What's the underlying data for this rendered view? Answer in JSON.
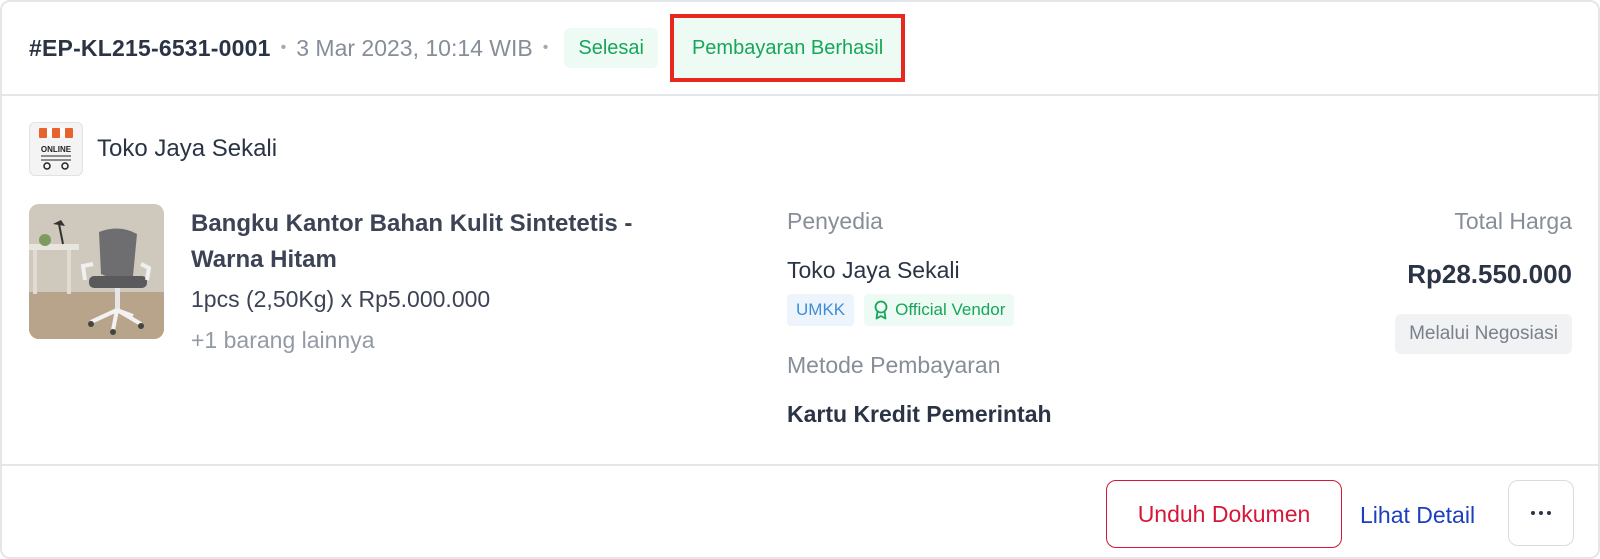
{
  "header": {
    "order_id": "#EP-KL215-6531-0001",
    "order_date": "3 Mar 2023, 10:14 WIB",
    "status_badge": "Selesai",
    "payment_badge": "Pembayaran Berhasil"
  },
  "shop": {
    "name": "Toko Jaya Sekali",
    "logo_text": "ONLINE SHOP"
  },
  "product": {
    "name": "Bangku Kantor Bahan Kulit Sintetetis - Warna Hitam",
    "quantity_price": "1pcs (2,50Kg) x Rp5.000.000",
    "more_items": "+1 barang lainnya"
  },
  "vendor": {
    "label": "Penyedia",
    "name": "Toko Jaya Sekali",
    "badge_umkk": "UMKK",
    "badge_official": "Official Vendor",
    "payment_label": "Metode Pembayaran",
    "payment_method": "Kartu Kredit Pemerintah"
  },
  "total": {
    "label": "Total Harga",
    "value": "Rp28.550.000",
    "negotiation_badge": "Melalui Negosiasi"
  },
  "actions": {
    "download_label": "Unduh Dokumen",
    "detail_label": "Lihat Detail",
    "more_icon": "more-horizontal-icon"
  },
  "colors": {
    "success": "#17a65a",
    "danger": "#d6173a",
    "link": "#1b3fbf",
    "highlight_box": "#e8281f"
  }
}
